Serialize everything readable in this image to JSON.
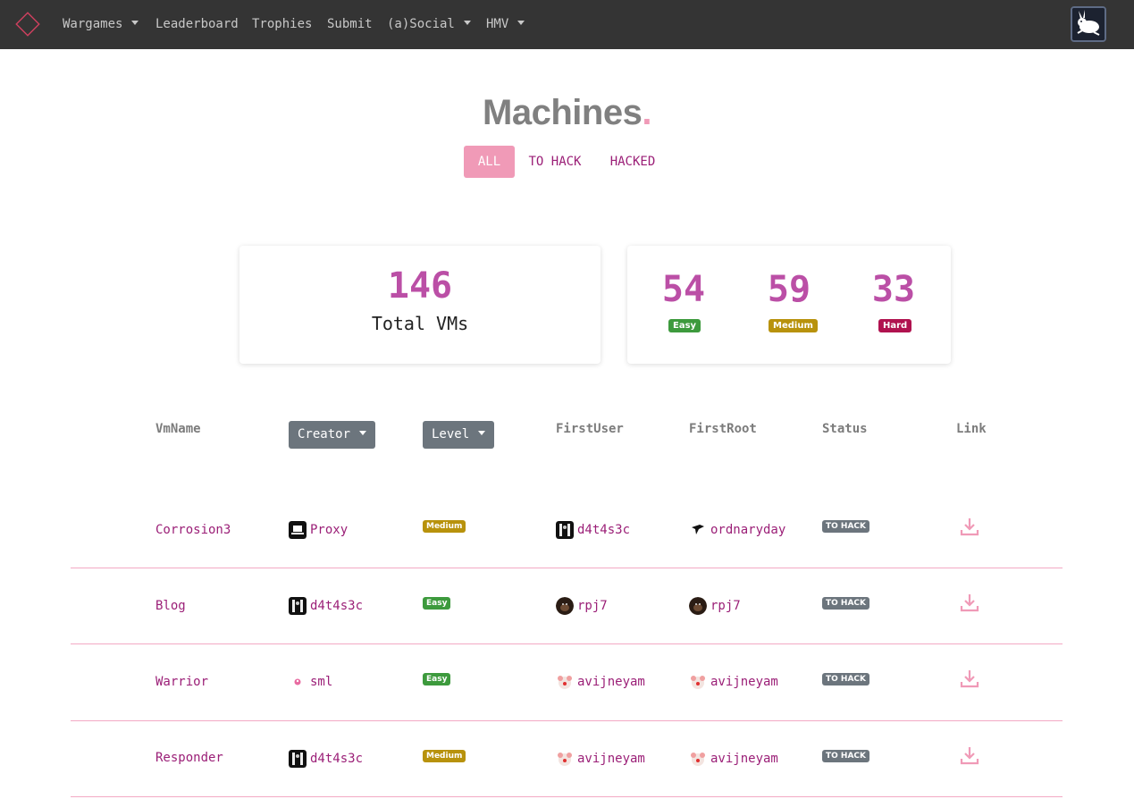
{
  "navbar": {
    "items": [
      {
        "label": "Wargames",
        "dropdown": true
      },
      {
        "label": "Leaderboard",
        "dropdown": false
      },
      {
        "label": "Trophies",
        "dropdown": false
      },
      {
        "label": "Submit",
        "dropdown": false
      },
      {
        "label": "(a)Social",
        "dropdown": true
      },
      {
        "label": "HMV",
        "dropdown": true
      }
    ],
    "avatar_icon": "rabbit-avatar-icon"
  },
  "header": {
    "title": "Machines",
    "title_dot": ".",
    "tabs": [
      "ALL",
      "TO HACK",
      "HACKED"
    ],
    "active_tab": "ALL"
  },
  "stats": {
    "total": "146",
    "total_label": "Total VMs",
    "easy": "54",
    "easy_label": "Easy",
    "medium": "59",
    "medium_label": "Medium",
    "hard": "33",
    "hard_label": "Hard"
  },
  "colors": {
    "accent": "#f09ab7",
    "link": "#9b1f77",
    "stat": "#bb4fa6",
    "easy": "#3d9a3d",
    "medium": "#b8920c",
    "hard": "#b0124f",
    "status_badge": "#6c757d"
  },
  "table": {
    "headers": {
      "vmname": "VmName",
      "creator": "Creator",
      "level": "Level",
      "firstuser": "FirstUser",
      "firstroot": "FirstRoot",
      "status": "Status",
      "link": "Link"
    },
    "rows": [
      {
        "vm": "Corrosion3",
        "creator": "Proxy",
        "level": "Medium",
        "first_user": "d4t4s3c",
        "first_root": "ordnaryday",
        "status": "TO HACK"
      },
      {
        "vm": "Blog",
        "creator": "d4t4s3c",
        "level": "Easy",
        "first_user": "rpj7",
        "first_root": "rpj7",
        "status": "TO HACK"
      },
      {
        "vm": "Warrior",
        "creator": "sml",
        "level": "Easy",
        "first_user": "avijneyam",
        "first_root": "avijneyam",
        "status": "TO HACK"
      },
      {
        "vm": "Responder",
        "creator": "d4t4s3c",
        "level": "Medium",
        "first_user": "avijneyam",
        "first_root": "avijneyam",
        "status": "TO HACK"
      }
    ]
  }
}
